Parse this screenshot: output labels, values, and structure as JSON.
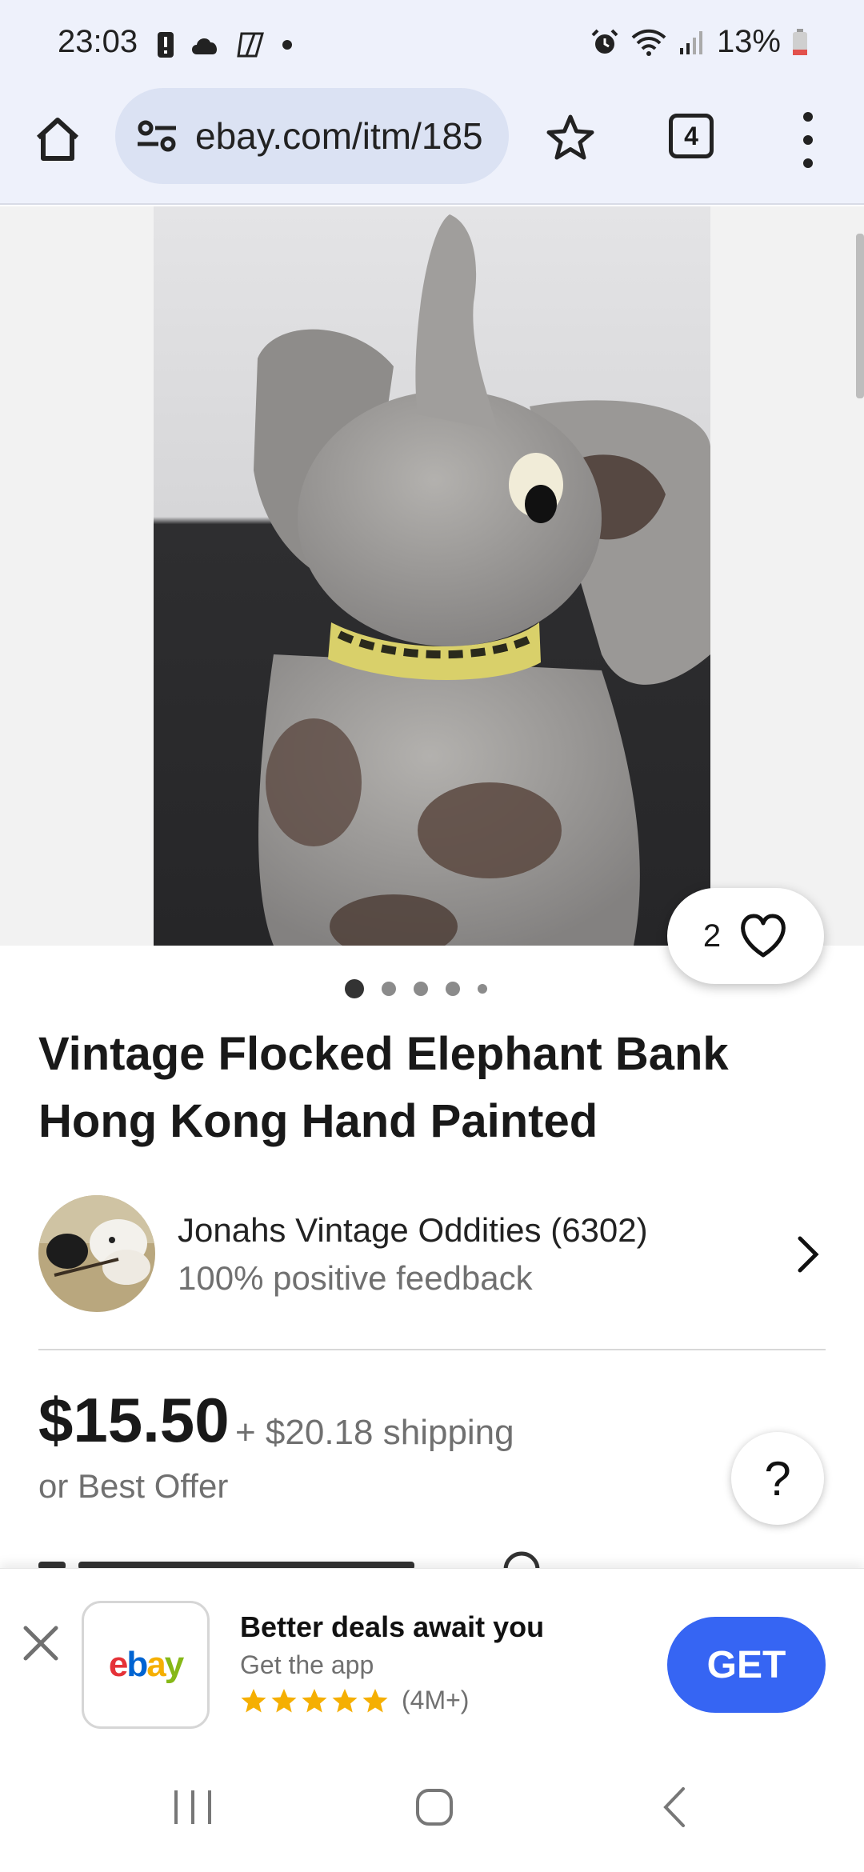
{
  "status_bar": {
    "time": "23:03",
    "battery": "13%",
    "left_icons": [
      "alert-icon",
      "cloud-icon",
      "copilot-icon",
      "dot-icon"
    ],
    "right_icons": [
      "alarm-icon",
      "wifi-icon",
      "signal-icon",
      "battery-icon"
    ]
  },
  "browser": {
    "url": "ebay.com/itm/185",
    "tab_count": "4"
  },
  "listing": {
    "watch_count": "2",
    "image_count": 5,
    "current_image": 1,
    "title": "Vintage Flocked Elephant Bank Hong Kong Hand Painted",
    "seller": {
      "name": "Jonahs Vintage Oddities (6302)",
      "feedback": "100% positive feedback"
    },
    "price": "$15.50",
    "shipping": "+ $20.18 shipping",
    "best_offer": "or Best Offer",
    "help_label": "?"
  },
  "app_banner": {
    "logo": [
      "e",
      "b",
      "a",
      "y"
    ],
    "title": "Better deals await you",
    "subtitle": "Get the app",
    "stars": 5,
    "rating_count": "(4M+)",
    "get_label": "GET"
  },
  "colors": {
    "ebay_blue": "#3665f3",
    "logo_e": "#e53238",
    "logo_b": "#0064d2",
    "logo_a": "#f5af02",
    "logo_y": "#86b817",
    "star": "#f5af02"
  }
}
